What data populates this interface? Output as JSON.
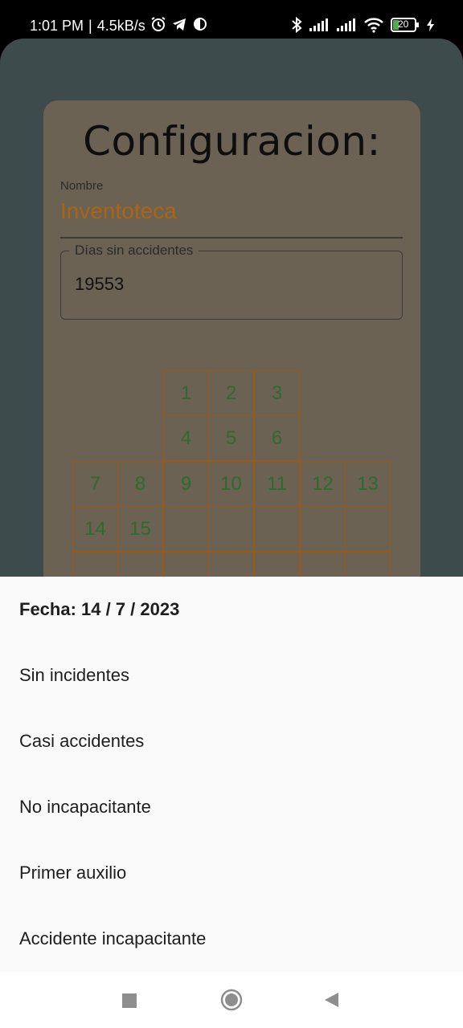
{
  "status_bar": {
    "time": "1:01 PM",
    "speed": "4.5kB/s",
    "battery": "20",
    "icons": [
      "alarm-icon",
      "telegram-icon",
      "app-icon",
      "bluetooth-icon",
      "signal-icon",
      "signal-icon",
      "wifi-icon",
      "battery-icon",
      "charging-icon"
    ]
  },
  "config": {
    "title": "Configuracion:",
    "name_label": "Nombre",
    "name_value": "Inventoteca",
    "days_label": "Días sin accidentes",
    "days_value": "19553"
  },
  "calendar": {
    "row1": [
      "1",
      "2",
      "3"
    ],
    "row2": [
      "4",
      "5",
      "6"
    ],
    "row3": [
      "7",
      "8",
      "9",
      "10",
      "11",
      "12",
      "13"
    ],
    "row4": [
      "14",
      "15",
      "",
      "",
      "",
      "",
      ""
    ]
  },
  "sheet": {
    "title": "Fecha: 14 / 7 / 2023",
    "options": [
      "Sin incidentes",
      "Casi accidentes",
      "No incapacitante",
      "Primer auxilio",
      "Accidente incapacitante"
    ]
  },
  "nav": {
    "icons": [
      "recents-icon",
      "home-icon",
      "back-icon"
    ]
  },
  "colors": {
    "accent_orange": "#a86616",
    "calendar_green": "#2e6a2c",
    "cell_border": "#9a5a17",
    "card_bg": "#6b6254",
    "app_bg": "#3e4b4d"
  }
}
